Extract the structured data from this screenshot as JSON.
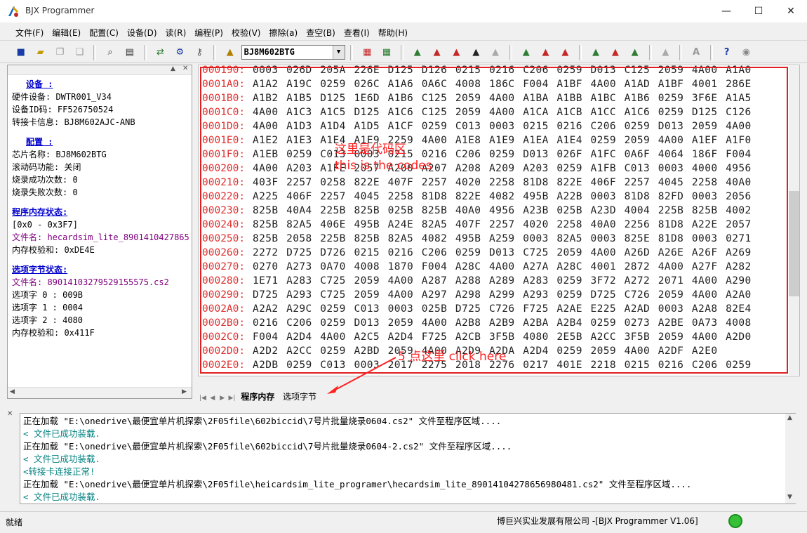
{
  "window": {
    "title": "BJX Programmer",
    "minimize": "—",
    "maximize": "☐",
    "close": "✕"
  },
  "menu": [
    "文件(F)",
    "编辑(E)",
    "配置(C)",
    "设备(D)",
    "读(R)",
    "编程(P)",
    "校验(V)",
    "擦除(a)",
    "查空(B)",
    "查看(I)",
    "帮助(H)"
  ],
  "toolbar": {
    "chip": "BJ8M602BTG"
  },
  "left_panel": {
    "device_header": "设备   :",
    "hardware": "硬件设备: DWTR001_V34",
    "device_id": "设备ID码: FF526750524",
    "adapter": "转接卡信息: BJ8M602AJC-ANB",
    "config_header": "配置   :",
    "chip_name": "芯片名称: BJ8M602BTG",
    "scroll_func": "滚动码功能: 关闭",
    "burn_ok": "烧录成功次数: 0",
    "burn_fail": "烧录失败次数: 0",
    "mem_header": "程序内存状态:",
    "range": "[0x0 - 0x3F7]",
    "filename1": "文件名: hecardsim_lite_8901410427865",
    "checksum1": "内存校验和: 0xDE4E",
    "opt_header": "选项字节状态:",
    "filename2": "文件名: 89014103279529155575.cs2",
    "opt0": "选项字 0 : 009B",
    "opt1": "选项字 1 : 0004",
    "opt2": "选项字 2 : 4080",
    "checksum2": "内存校验和: 0x411F"
  },
  "hex_rows": [
    {
      "addr": "000190:",
      "vals": "0003 026D 205A 226E D125 D126 0215 0216 C206 0259 D013 C125 2059 4A00 A1A0"
    },
    {
      "addr": "0001A0:",
      "vals": "A1A2 A19C 0259 026C A1A6 0A6C 4008 186C F004 A1BF 4A00 A1AD A1BF 4001 286E"
    },
    {
      "addr": "0001B0:",
      "vals": "A1B2 A1B5 D125 1E6D A1B6 C125 2059 4A00 A1BA A1BB A1BC A1B6 0259 3F6E A1A5"
    },
    {
      "addr": "0001C0:",
      "vals": "4A00 A1C3 A1C5 D125 A1C6 C125 2059 4A00 A1CA A1CB A1CC A1C6 0259 D125 C126"
    },
    {
      "addr": "0001D0:",
      "vals": "4A00 A1D3 A1D4 A1D5 A1CF 0259 C013 0003 0215 0216 C206 0259 D013 2059 4A00"
    },
    {
      "addr": "0001E0:",
      "vals": "A1E2 A1E3 A1E4 A1E9 2259 4A00 A1E8 A1E9 A1EA A1E4 0259 2059 4A00 A1EF A1F0"
    },
    {
      "addr": "0001F0:",
      "vals": "A1EB 0259 C013 0003 0215 0216 C206 0259 D013 026F A1FC 0A6F 4064 186F F004"
    },
    {
      "addr": "000200:",
      "vals": "4A00 A203 A1FE 2057 A200 A207 A208 A209 A203 0259 A1FB C013 0003 4000 4956"
    },
    {
      "addr": "000210:",
      "vals": "403F 2257 0258 822E 407F 2257 4020 2258 81D8 822E 406F 2257 4045 2258 40A0"
    },
    {
      "addr": "000220:",
      "vals": "A225 406F 2257 4045 2258 81D8 822E 4082 495B A22B 0003 81D8 82FD 0003 2056"
    },
    {
      "addr": "000230:",
      "vals": "825B 40A4 225B 825B 025B 825B 40A0 4956 A23B 025B A23D 4004 225B 825B 4002"
    },
    {
      "addr": "000240:",
      "vals": "825B 82A5 406E 495B A24E 82A5 407F 2257 4020 2258 40A0 2256 81D8 A22E 2057"
    },
    {
      "addr": "000250:",
      "vals": "825B 2058 225B 825B 82A5 4082 495B A259 0003 82A5 0003 825E 81D8 0003 0271"
    },
    {
      "addr": "000260:",
      "vals": "2272 D725 D726 0215 0216 C206 0259 D013 C725 2059 4A00 A26D A26E A26F A269"
    },
    {
      "addr": "000270:",
      "vals": "0270 A273 0A70 4008 1870 F004 A28C 4A00 A27A A28C 4001 2872 4A00 A27F A282"
    },
    {
      "addr": "000280:",
      "vals": "1E71 A283 C725 2059 4A00 A287 A288 A289 A283 0259 3F72 A272 2071 4A00 A290"
    },
    {
      "addr": "000290:",
      "vals": "D725 A293 C725 2059 4A00 A297 A298 A299 A293 0259 D725 C726 2059 4A00 A2A0"
    },
    {
      "addr": "0002A0:",
      "vals": "A2A2 A29C 0259 C013 0003 025B D725 C726 F725 A2AE E225 A2AD 0003 A2A8 82E4"
    },
    {
      "addr": "0002B0:",
      "vals": "0216 C206 0259 D013 2059 4A00 A2B8 A2B9 A2BA A2B4 0259 0273 A2BE 0A73 4008"
    },
    {
      "addr": "0002C0:",
      "vals": "F004 A2D4 4A00 A2C5 A2D4 F725 A2CB 3F5B 4080 2E5B A2CC 3F5B 2059 4A00 A2D0"
    },
    {
      "addr": "0002D0:",
      "vals": "A2D2 A2CC 0259 A2BD 2059 4A00 A2D9 A2DA A2D4 0259 2059 4A00 A2DF A2E0"
    },
    {
      "addr": "0002E0:",
      "vals": "A2DB 0259 C013 0003 2017 2275 2018 2276 0217 401E 2218 0215 0216 C206 0259"
    }
  ],
  "annotations": {
    "codes_cn": "这里是代码区",
    "codes_en": "this is the codes",
    "click_here": "5 点这里 click here"
  },
  "tabs": {
    "program_memory": "程序内存",
    "option_bytes": "选项字节"
  },
  "log": [
    {
      "text": "正在加载 \"E:\\onedrive\\最便宜单片机探索\\2F05file\\602biccid\\7号片批量烧录0604.cs2\" 文件至程序区域....",
      "type": "normal"
    },
    {
      "text": "< 文件已成功装载.",
      "type": "ok"
    },
    {
      "text": "正在加载 \"E:\\onedrive\\最便宜单片机探索\\2F05file\\602biccid\\7号片批量烧录0604-2.cs2\" 文件至程序区域....",
      "type": "normal"
    },
    {
      "text": "< 文件已成功装载.",
      "type": "ok"
    },
    {
      "text": "<转接卡连接正常!",
      "type": "ok"
    },
    {
      "text": "正在加载 \"E:\\onedrive\\最便宜单片机探索\\2F05file\\heicardsim_lite_programer\\hecardsim_lite_89014104278656980481.cs2\" 文件至程序区域....",
      "type": "normal"
    },
    {
      "text": "< 文件已成功装载.",
      "type": "ok"
    }
  ],
  "status": {
    "ready": "就绪",
    "company": "博巨兴实业发展有限公司 -[BJX Programmer V1.06]"
  },
  "colors": {
    "address": "#e03030",
    "annotation": "#ff2020",
    "log_ok": "#008080",
    "section_header": "#0000cc"
  }
}
